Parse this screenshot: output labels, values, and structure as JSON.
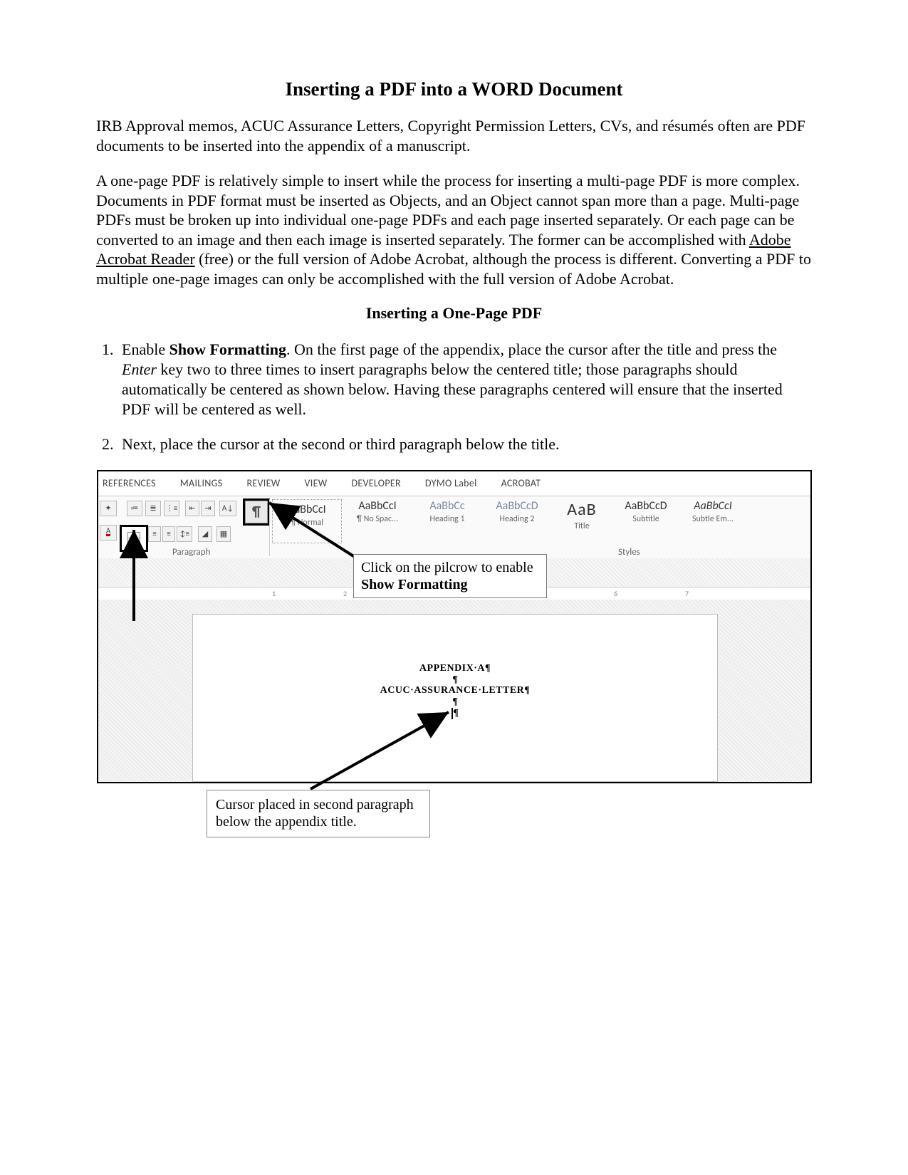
{
  "title": "Inserting a PDF into a WORD Document",
  "intro1": "IRB Approval memos, ACUC Assurance Letters, Copyright Permission Letters, CVs, and résumés often are PDF documents to be inserted into the appendix of a manuscript.",
  "intro2a": "A one-page PDF is relatively simple to insert while the process for inserting a multi-page PDF is more complex. Documents in PDF format must be inserted as Objects, and an Object cannot span more than a page. Multi-page PDFs must be broken up into individual one-page PDFs and each page inserted separately. Or each page can be converted to an image and then each image is inserted separately. The former can be accomplished with ",
  "intro2_link": "Adobe Acrobat Reader",
  "intro2b": " (free) or the full version of Adobe Acrobat, although the process is different. Converting a PDF to multiple one-page images can only be accomplished with the full version of Adobe Acrobat.",
  "subheading": "Inserting a One-Page PDF",
  "steps": {
    "1": {
      "pre": "Enable ",
      "bold": "Show Formatting",
      "mid": ". On the first page of the appendix, place the cursor after the title and press the ",
      "italic": "Enter",
      "post": " key two to three times to insert paragraphs below the centered title; those paragraphs should automatically be centered as shown below. Having these paragraphs centered will ensure that the inserted PDF will be centered as well."
    },
    "2": "Next, place the cursor at the second or third paragraph below the title."
  },
  "ribbon_tabs": [
    "REFERENCES",
    "MAILINGS",
    "REVIEW",
    "VIEW",
    "DEVELOPER",
    "DYMO Label",
    "ACROBAT"
  ],
  "style_tiles": {
    "normal": {
      "sample": "AaBbCcI",
      "label": "Normal"
    },
    "nospac": {
      "sample": "AaBbCcI",
      "label": "No Spac..."
    },
    "h1": {
      "sample": "AaBbCc",
      "label": "Heading 1"
    },
    "h2": {
      "sample": "AaBbCcD",
      "label": "Heading 2"
    },
    "title": {
      "sample": "AaB",
      "label": "Title"
    },
    "subtitle": {
      "sample": "AaBbCcD",
      "label": "Subtitle"
    },
    "subtle": {
      "sample": "AaBbCcI",
      "label": "Subtle Em..."
    }
  },
  "group_labels": {
    "paragraph": "Paragraph",
    "styles": "Styles"
  },
  "callouts": {
    "pilcrow_a": "Click on the pilcrow to enable ",
    "pilcrow_b": "Show Formatting",
    "cursor": "Cursor placed in second paragraph below the appendix title."
  },
  "docpage": {
    "line1": "APPENDIX·A¶",
    "pil": "¶",
    "line2": "ACUC·ASSURANCE·LETTER¶"
  },
  "pilcrow_glyph": "¶"
}
